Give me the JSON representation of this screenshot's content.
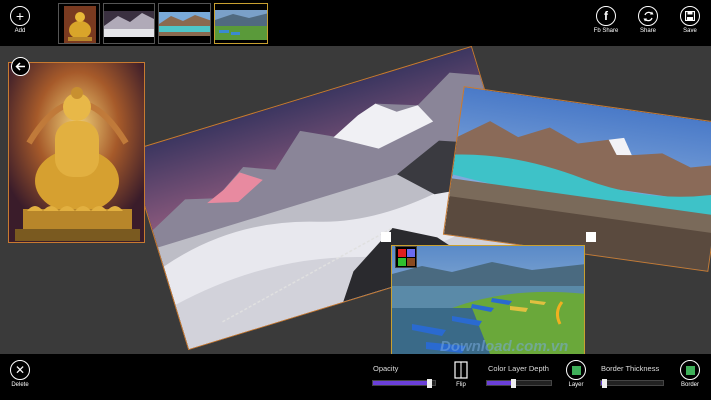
{
  "toolbar": {
    "add_label": "Add",
    "fb_share_label": "Fb Share",
    "share_label": "Share",
    "save_label": "Save"
  },
  "bottom": {
    "delete_label": "Delete",
    "opacity_label": "Opacity",
    "opacity_value": 0.9,
    "flip_label": "Flip",
    "color_layer_depth_label": "Color Layer Depth",
    "color_layer_depth_value": 0.4,
    "layer_label": "Layer",
    "border_thickness_label": "Border Thickness",
    "border_thickness_value": 0.05,
    "border_label": "Border"
  },
  "colors": {
    "accent": "#6a3fd8",
    "selected_border": "#c8a030",
    "swatches": [
      "#e02020",
      "#6a6af0",
      "#30c030",
      "#8a4a20"
    ]
  },
  "watermark": "Download.com.vn"
}
